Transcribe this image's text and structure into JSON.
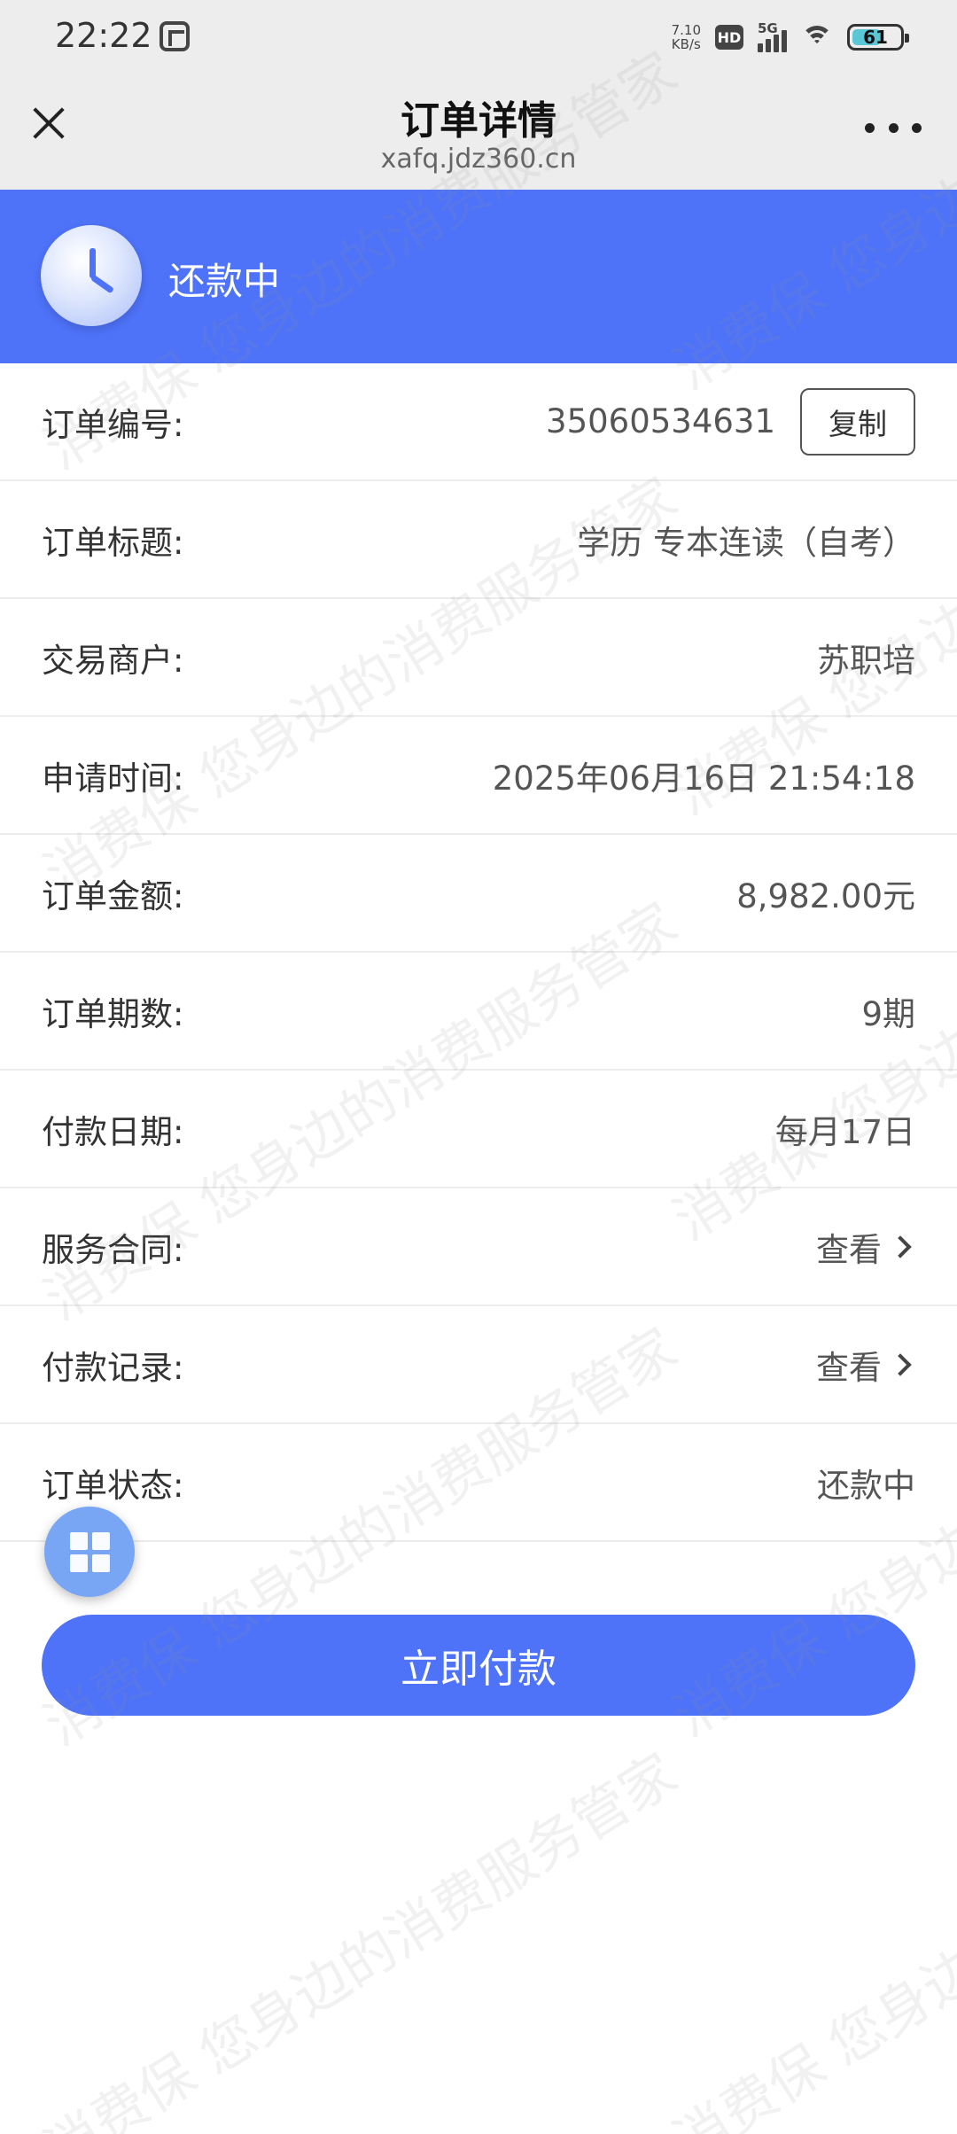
{
  "status_bar": {
    "time": "22:22",
    "net_speed_value": "7.10",
    "net_speed_unit": "KB/s",
    "hd_label": "HD",
    "network_label": "5G",
    "battery_level": 61,
    "battery_text": "61",
    "battery_fill_color": "#5bc6d6"
  },
  "nav": {
    "title": "订单详情",
    "subtitle": "xafq.jdz360.cn",
    "close_icon": "close-icon",
    "more_icon": "more-icon"
  },
  "banner": {
    "status": "还款中",
    "icon": "clock-icon",
    "background_color": "#4e72f8"
  },
  "details": {
    "order_no": {
      "label": "订单编号:",
      "value": "35060534631",
      "copy_label": "复制"
    },
    "order_title": {
      "label": "订单标题:",
      "value": "学历 专本连读（自考）"
    },
    "merchant": {
      "label": "交易商户:",
      "value": "苏职培"
    },
    "apply_time": {
      "label": "申请时间:",
      "value": "2025年06月16日 21:54:18"
    },
    "amount": {
      "label": "订单金额:",
      "value": "8,982.00元"
    },
    "periods": {
      "label": "订单期数:",
      "value": "9期"
    },
    "pay_date": {
      "label": "付款日期:",
      "value": "每月17日"
    },
    "contract": {
      "label": "服务合同:",
      "value": "查看"
    },
    "pay_records": {
      "label": "付款记录:",
      "value": "查看"
    },
    "order_status": {
      "label": "订单状态:",
      "value": "还款中"
    }
  },
  "floating_button": {
    "icon": "grid-icon"
  },
  "pay_button": {
    "label": "立即付款",
    "color": "#4e72f8"
  },
  "watermark": {
    "text": "消费保 您身边的消费服务管家"
  }
}
